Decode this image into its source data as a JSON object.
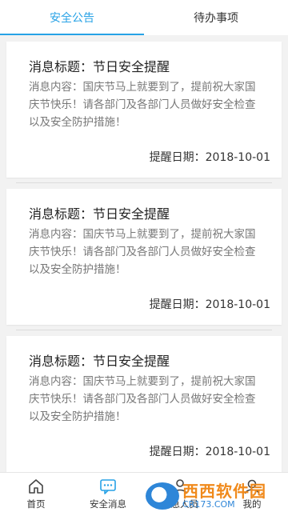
{
  "tabs": [
    {
      "label": "安全公告",
      "active": true
    },
    {
      "label": "待办事项",
      "active": false
    }
  ],
  "cards": [
    {
      "title": "消息标题：节日安全提醒",
      "content": "消息内容：国庆节马上就要到了，提前祝大家国庆节快乐！请各部门及各部门人员做好安全检查以及安全防护措施！",
      "date": "提醒日期：2018-10-01"
    },
    {
      "title": "消息标题：节日安全提醒",
      "content": "消息内容：国庆节马上就要到了，提前祝大家国庆节快乐！请各部门及各部门人员做好安全检查以及安全防护措施！",
      "date": "提醒日期：2018-10-01"
    },
    {
      "title": "消息标题：节日安全提醒",
      "content": "消息内容：国庆节马上就要到了，提前祝大家国庆节快乐！请各部门及各部门人员做好安全检查以及安全防护措施！",
      "date": "提醒日期：2018-10-01"
    }
  ],
  "nav": [
    {
      "label": "首页",
      "icon": "home-icon"
    },
    {
      "label": "安全消息",
      "icon": "message-icon",
      "active": true
    },
    {
      "label": "应急人员",
      "icon": "person-icon"
    },
    {
      "label": "我的",
      "icon": "user-icon"
    }
  ],
  "watermark": {
    "main": "西西软件园",
    "sub": "CR173.COM"
  },
  "colors": {
    "accent": "#27a2e6",
    "background": "#f2f2f2"
  }
}
